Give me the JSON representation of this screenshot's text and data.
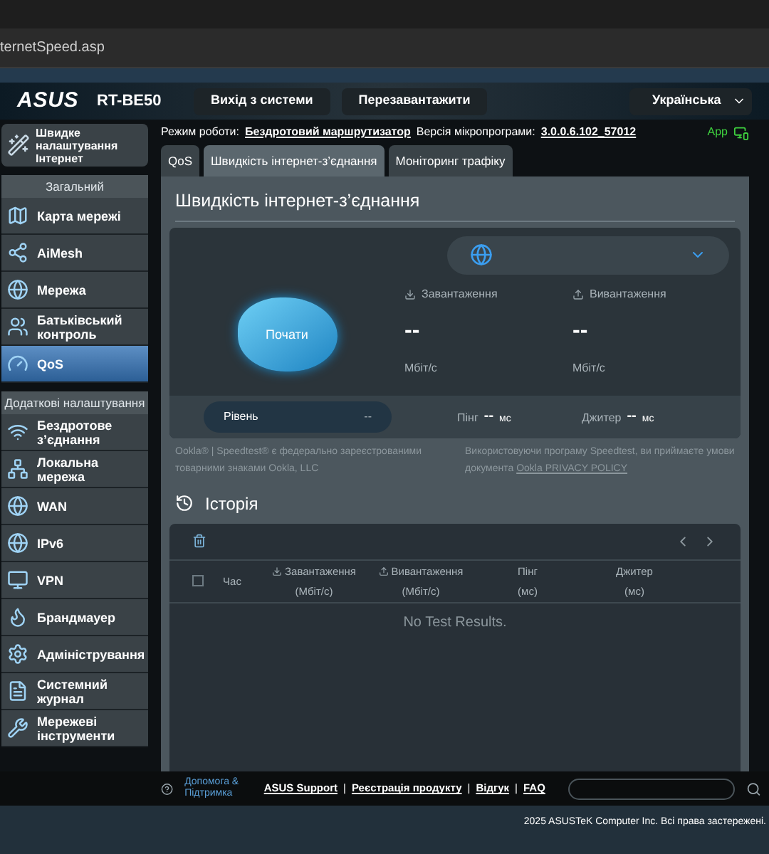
{
  "browser": {
    "url": "ternetSpeed.asp"
  },
  "header": {
    "logo": "ASUS",
    "model": "RT-BE50",
    "buttons": [
      "Вихід з системи",
      "Перезавантажити"
    ],
    "language": "Українська"
  },
  "status": {
    "mode_label": "Режим роботи:",
    "mode_value": "Бездротовий маршрутизатор",
    "firmware_label": "Версія мікропрограми:",
    "firmware_value": "3.0.0.6.102_57012",
    "app_label": "App"
  },
  "sidebar": {
    "quick_setup": "Швидке налаштування Інтернет",
    "sections": [
      {
        "title": "Загальний",
        "items": [
          {
            "label": "Карта мережі",
            "selected": false
          },
          {
            "label": "AiMesh",
            "selected": false
          },
          {
            "label": "Мережа",
            "selected": false
          },
          {
            "label": "Батьківський контроль",
            "selected": false
          },
          {
            "label": "QoS",
            "selected": true
          }
        ]
      },
      {
        "title": "Додаткові налаштування",
        "items": [
          {
            "label": "Бездротове з’єднання",
            "selected": false
          },
          {
            "label": "Локальна мережа",
            "selected": false
          },
          {
            "label": "WAN",
            "selected": false
          },
          {
            "label": "IPv6",
            "selected": false
          },
          {
            "label": "VPN",
            "selected": false
          },
          {
            "label": "Брандмауер",
            "selected": false
          },
          {
            "label": "Адміністрування",
            "selected": false
          },
          {
            "label": "Системний журнал",
            "selected": false
          },
          {
            "label": "Мережеві інструменти",
            "selected": false
          }
        ]
      }
    ]
  },
  "tabs": [
    {
      "label": "QoS",
      "selected": false
    },
    {
      "label": "Швидкість інтернет-з’єднання",
      "selected": true
    },
    {
      "label": "Моніторинг трафіку",
      "selected": false
    }
  ],
  "speedtest": {
    "title": "Швидкість інтернет-з’єднання",
    "start_button": "Почати",
    "metrics": [
      {
        "label": "Завантаження",
        "value": "--",
        "unit": "Мбіт/с"
      },
      {
        "label": "Вивантаження",
        "value": "--",
        "unit": "Мбіт/с"
      }
    ],
    "level_label": "Рівень",
    "level_value": "--",
    "latency": [
      {
        "label": "Пінг",
        "value": "--",
        "unit": "мс"
      },
      {
        "label": "Джитер",
        "value": "--",
        "unit": "мс"
      }
    ],
    "legal_left": "Ookla® | Speedtest® є федерально зареєстрованими товарними знаками Ookla, LLC",
    "legal_right": "Використовуючи програму Speedtest, ви приймаєте умови документа",
    "legal_link": "Ookla PRIVACY POLICY"
  },
  "history": {
    "title": "Історія",
    "select_all_checked": false,
    "columns": [
      {
        "label": "Час"
      },
      {
        "label": "Завантаження",
        "unit": "(Мбіт/с)",
        "kind": "download"
      },
      {
        "label": "Вивантаження",
        "unit": "(Мбіт/с)",
        "kind": "upload"
      },
      {
        "label": "Пінг",
        "unit": "(мс)"
      },
      {
        "label": "Джитер",
        "unit": "(мс)"
      }
    ],
    "empty": "No Test Results."
  },
  "footer": {
    "help": "Допомога & Підтримка",
    "links": [
      "ASUS Support",
      "Реєстрація продукту",
      "Відгук",
      "FAQ"
    ],
    "separators": [
      "|",
      "|",
      "|"
    ],
    "copyright": "2025 ASUSTeK Computer Inc. Всі права застережені."
  }
}
